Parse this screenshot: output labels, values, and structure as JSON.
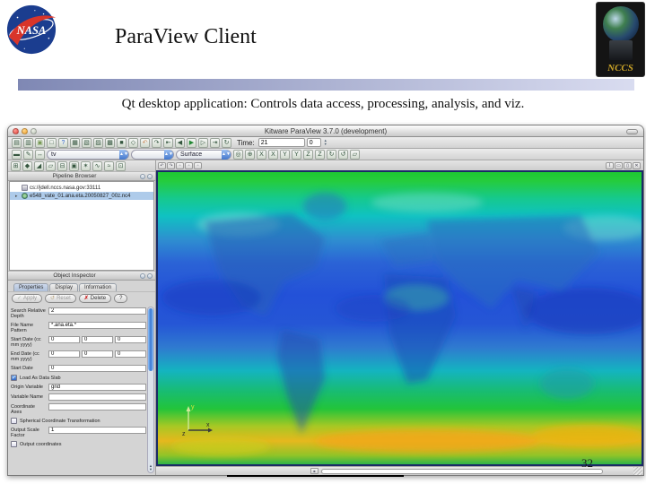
{
  "slide": {
    "title": "ParaView Client",
    "subtitle": "Qt desktop application: Controls data access, processing, analysis, and viz.",
    "page_number": "32"
  },
  "logos": {
    "nasa_text": "NASA",
    "nccs_text": "NCCS"
  },
  "window": {
    "title": "Kitware ParaView 3.7.0 (development)",
    "toolbars": {
      "row1_icons": [
        "open-data-icon",
        "save-data-icon",
        "connect-server-icon",
        "disconnect-server-icon",
        "help-icon",
        "select-cells-on-icon",
        "select-points-on-icon",
        "select-cells-through-icon",
        "select-points-through-icon",
        "select-block-icon",
        "interact-icon",
        "undo-icon",
        "redo-icon",
        "vcr-first-frame-icon",
        "vcr-previous-frame-icon",
        "vcr-play-icon",
        "vcr-next-frame-icon",
        "vcr-last-frame-icon",
        "vcr-loop-icon"
      ],
      "time_label": "Time:",
      "time_value": "21",
      "frame_value": "0",
      "row2_icons_left": [
        "toggle-color-legend-icon",
        "edit-color-map-icon",
        "rescale-to-data-range-icon"
      ],
      "variable_combo": "tv",
      "component_combo": "",
      "representation_combo": "Surface",
      "row2_icons_right": [
        "reset-camera-icon",
        "zoom-to-data-icon",
        "view-x-plus-icon",
        "view-x-minus-icon",
        "view-y-plus-icon",
        "view-y-minus-icon",
        "view-z-plus-icon",
        "view-z-minus-icon",
        "rotate-90-cw-icon",
        "rotate-90-ccw-icon",
        "parallel-projection-icon"
      ],
      "row3_icons": [
        "calculator-filter-icon",
        "contour-filter-icon",
        "clip-filter-icon",
        "slice-filter-icon",
        "threshold-filter-icon",
        "extract-subset-filter-icon",
        "glyph-filter-icon",
        "stream-tracer-filter-icon",
        "warp-vector-filter-icon",
        "group-datasets-filter-icon"
      ]
    },
    "pipeline_browser": {
      "header": "Pipeline Browser",
      "items": [
        {
          "label": "cs://jdell.nccs.nasa.gov:33111",
          "selected": false,
          "icon": "server-icon"
        },
        {
          "label": "e548_vate_01.ana.eta.20050827_00z.nc4",
          "selected": true,
          "icon": "eye-icon"
        }
      ]
    },
    "object_inspector": {
      "header": "Object Inspector",
      "tabs": [
        {
          "label": "Properties",
          "active": true
        },
        {
          "label": "Display",
          "active": false
        },
        {
          "label": "Information",
          "active": false
        }
      ],
      "apply_label": "Apply",
      "reset_label": "Reset",
      "delete_label": "Delete",
      "help_label": "?",
      "fields": [
        {
          "type": "text",
          "label": "Search Relative Depth",
          "value": "2"
        },
        {
          "type": "text",
          "label": "File Name Pattern",
          "value": "*.ana.eta.*"
        },
        {
          "type": "triple",
          "label": "Start Date (cc mm yyyy)",
          "values": [
            "0",
            "0",
            "0"
          ]
        },
        {
          "type": "triple",
          "label": "End Date (cc mm yyyy)",
          "values": [
            "0",
            "0",
            "0"
          ]
        },
        {
          "type": "text",
          "label": "Start Date",
          "value": "0"
        },
        {
          "type": "check",
          "label": "Load As Data Slab",
          "checked": true
        },
        {
          "type": "text",
          "label": "Origin Variable",
          "value": "grid"
        },
        {
          "type": "text",
          "label": "Variable Name",
          "value": ""
        },
        {
          "type": "text",
          "label": "Coordinate Axes",
          "value": ""
        },
        {
          "type": "check",
          "label": "Spherical Coordinate Transformation",
          "checked": false
        },
        {
          "type": "text",
          "label": "Output Scale Factor",
          "value": "1"
        },
        {
          "type": "check",
          "label": "Output coordinates",
          "checked": false
        }
      ]
    },
    "view": {
      "header_left_icons": [
        "view-undo-camera-icon",
        "view-redo-camera-icon",
        "view-lock-icon",
        "view-picture-icon",
        "view-options-icon"
      ],
      "header_right_icons": [
        "view-convert-icon",
        "split-horizontal-icon",
        "split-vertical-icon",
        "close-view-icon"
      ],
      "axes": {
        "x": "x",
        "y": "y",
        "z": "z"
      }
    }
  }
}
